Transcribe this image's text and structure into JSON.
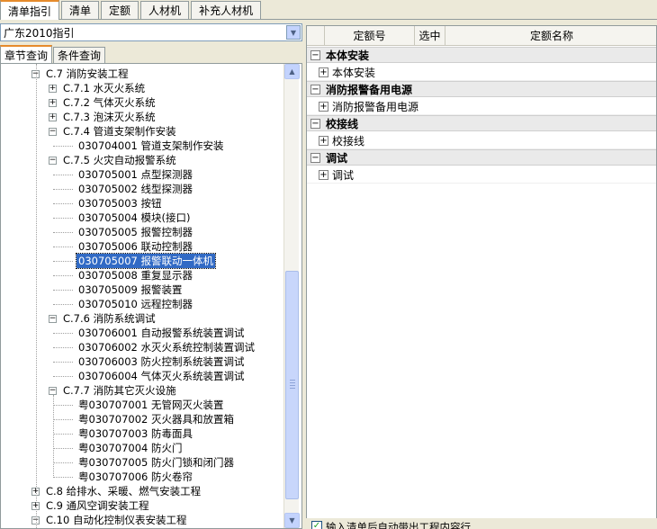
{
  "top_tabs": [
    {
      "label": "清单指引",
      "active": true
    },
    {
      "label": "清单",
      "active": false
    },
    {
      "label": "定额",
      "active": false
    },
    {
      "label": "人材机",
      "active": false
    },
    {
      "label": "补充人材机",
      "active": false
    }
  ],
  "left": {
    "combo_value": "广东2010指引",
    "sub_tabs": [
      {
        "label": "章节查询",
        "active": true
      },
      {
        "label": "条件查询",
        "active": false
      }
    ],
    "tree": [
      {
        "level": 0,
        "toggle": "-",
        "label": "C.7 消防安装工程"
      },
      {
        "level": 1,
        "toggle": "+",
        "label": "C.7.1 水灭火系统"
      },
      {
        "level": 1,
        "toggle": "+",
        "label": "C.7.2 气体灭火系统"
      },
      {
        "level": 1,
        "toggle": "+",
        "label": "C.7.3 泡沫灭火系统"
      },
      {
        "level": 1,
        "toggle": "-",
        "label": "C.7.4 管道支架制作安装"
      },
      {
        "level": 2,
        "toggle": "",
        "label": "030704001  管道支架制作安装"
      },
      {
        "level": 1,
        "toggle": "-",
        "label": "C.7.5 火灾自动报警系统"
      },
      {
        "level": 2,
        "toggle": "",
        "label": "030705001  点型探测器"
      },
      {
        "level": 2,
        "toggle": "",
        "label": "030705002  线型探测器"
      },
      {
        "level": 2,
        "toggle": "",
        "label": "030705003  按钮"
      },
      {
        "level": 2,
        "toggle": "",
        "label": "030705004  模块(接口)"
      },
      {
        "level": 2,
        "toggle": "",
        "label": "030705005  报警控制器"
      },
      {
        "level": 2,
        "toggle": "",
        "label": "030705006  联动控制器"
      },
      {
        "level": 2,
        "toggle": "",
        "label": "030705007  报警联动一体机",
        "selected": true
      },
      {
        "level": 2,
        "toggle": "",
        "label": "030705008  重复显示器"
      },
      {
        "level": 2,
        "toggle": "",
        "label": "030705009  报警装置"
      },
      {
        "level": 2,
        "toggle": "",
        "label": "030705010  远程控制器"
      },
      {
        "level": 1,
        "toggle": "-",
        "label": "C.7.6 消防系统调试"
      },
      {
        "level": 2,
        "toggle": "",
        "label": "030706001  自动报警系统装置调试"
      },
      {
        "level": 2,
        "toggle": "",
        "label": "030706002  水灭火系统控制装置调试"
      },
      {
        "level": 2,
        "toggle": "",
        "label": "030706003  防火控制系统装置调试"
      },
      {
        "level": 2,
        "toggle": "",
        "label": "030706004  气体灭火系统装置调试"
      },
      {
        "level": 1,
        "toggle": "-",
        "label": "C.7.7 消防其它灭火设施"
      },
      {
        "level": 2,
        "toggle": "",
        "label": "粤030707001  无管网灭火装置"
      },
      {
        "level": 2,
        "toggle": "",
        "label": "粤030707002  灭火器具和放置箱"
      },
      {
        "level": 2,
        "toggle": "",
        "label": "粤030707003  防毒面具"
      },
      {
        "level": 2,
        "toggle": "",
        "label": "粤030707004  防火门"
      },
      {
        "level": 2,
        "toggle": "",
        "label": "粤030707005  防火门锁和闭门器"
      },
      {
        "level": 2,
        "toggle": "",
        "label": "粤030707006  防火卷帘"
      },
      {
        "level": 0,
        "toggle": "+",
        "label": "C.8 给排水、采暖、燃气安装工程"
      },
      {
        "level": 0,
        "toggle": "+",
        "label": "C.9 通风空调安装工程"
      },
      {
        "level": 0,
        "toggle": "-",
        "label": "C.10 自动化控制仪表安装工程"
      }
    ]
  },
  "right": {
    "columns": [
      "定额号",
      "选中",
      "定额名称"
    ],
    "groups": [
      {
        "label": "本体安装",
        "item": "本体安装"
      },
      {
        "label": "消防报警备用电源",
        "item": "消防报警备用电源"
      },
      {
        "label": "校接线",
        "item": "校接线"
      },
      {
        "label": "调试",
        "item": "调试"
      }
    ],
    "bottom_checkbox_label": "输入清单后自动带出工程内容行",
    "bottom_checkbox_checked": true
  },
  "icons": {
    "combo_dropdown": "chevron-down-icon",
    "scroll_up": "arrow-up-icon",
    "scroll_down": "arrow-down-icon",
    "tree_expand": "plus-box-icon",
    "tree_collapse": "minus-box-icon",
    "check": "checkmark-icon"
  }
}
